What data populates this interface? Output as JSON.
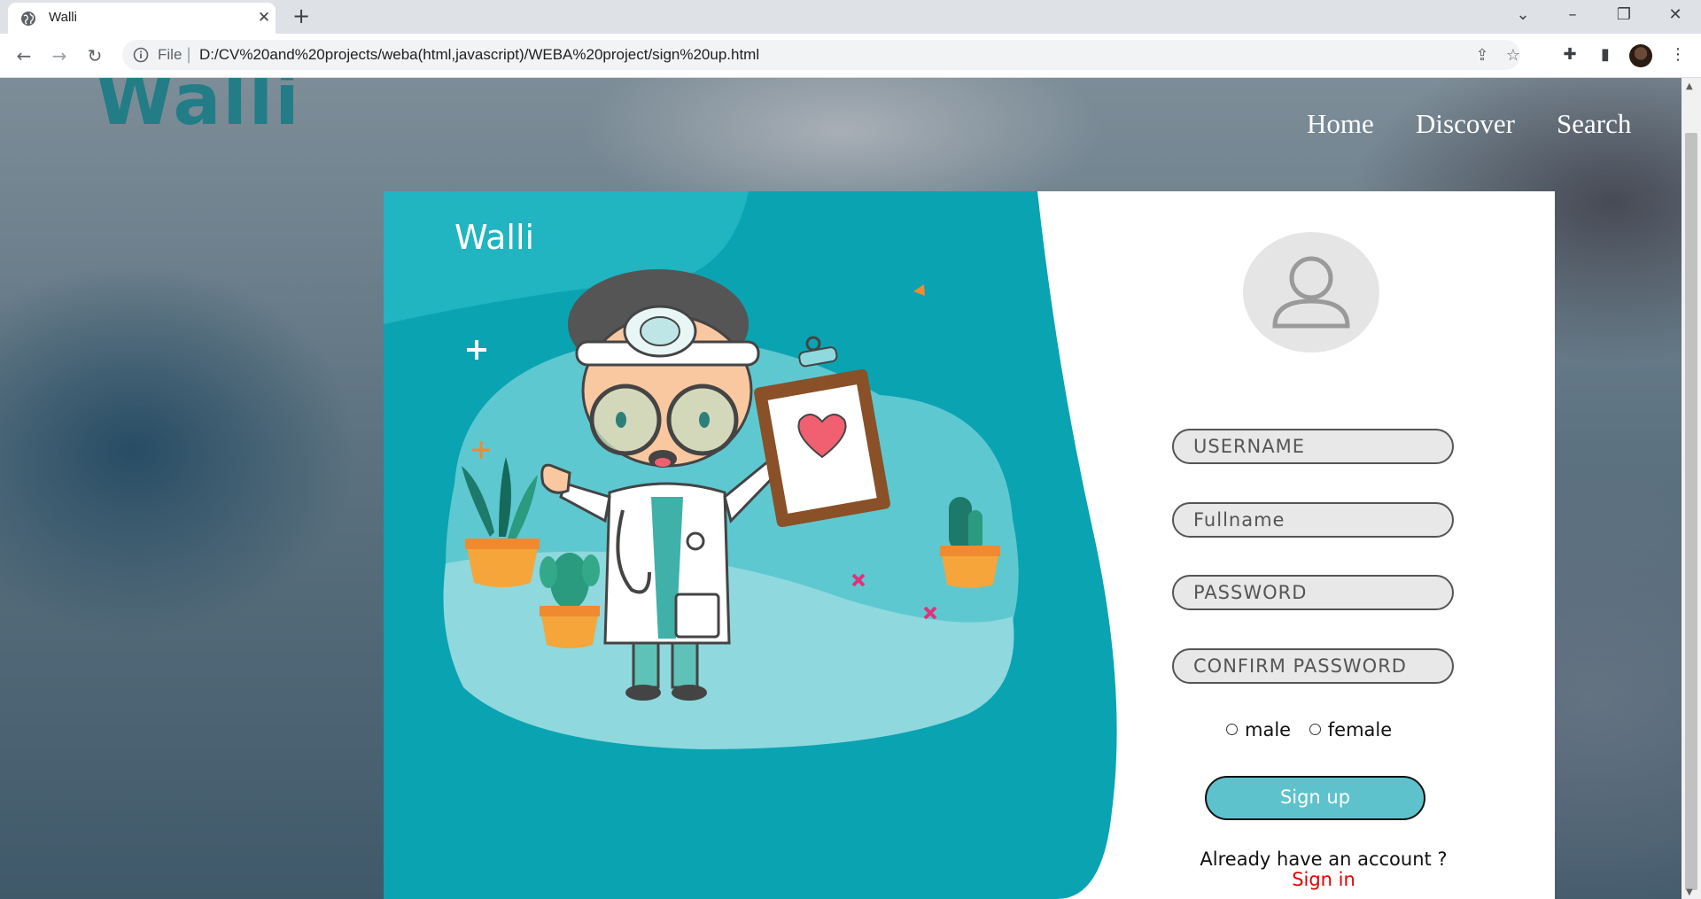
{
  "browser": {
    "tab_title": "Walli",
    "file_label": "File",
    "url": "D:/CV%20and%20projects/weba(html,javascript)/WEBA%20project/sign%20up.html"
  },
  "site": {
    "logo": "Walli",
    "nav": [
      "Home",
      "Discover",
      "Search"
    ]
  },
  "card": {
    "brand": "Walli",
    "fields": {
      "username_placeholder": "USERNAME",
      "fullname_placeholder": "Fullname",
      "password_placeholder": "PASSWORD",
      "confirm_placeholder": "CONFIRM PASSWORD"
    },
    "gender": {
      "male": "male",
      "female": "female"
    },
    "signup_label": "Sign up",
    "already_text": "Already have an account ?",
    "signin_link": "Sign in"
  },
  "colors": {
    "teal_panel": "#0aa3b1",
    "signup_button": "#5ec2cd",
    "signin_link": "#e00000",
    "logo": "#1e7d86"
  },
  "icons": [
    "globe-icon",
    "close-icon",
    "plus-icon",
    "back-icon",
    "forward-icon",
    "reload-icon",
    "info-icon",
    "share-icon",
    "star-icon",
    "extensions-icon",
    "sidepanel-icon",
    "menu-icon",
    "user-icon"
  ]
}
